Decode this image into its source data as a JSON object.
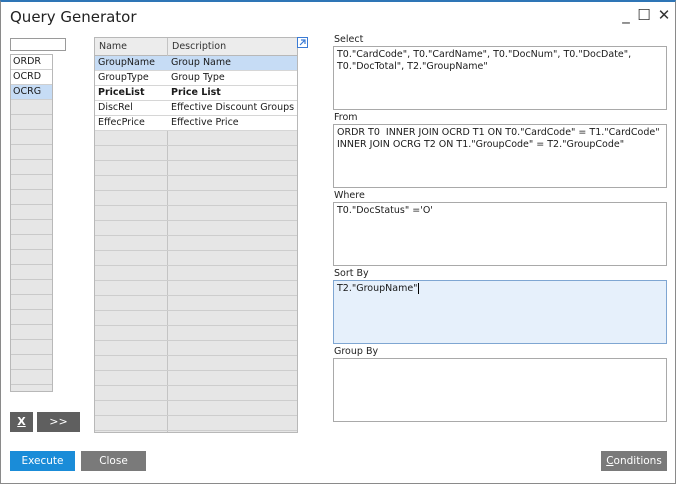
{
  "window": {
    "title": "Query Generator",
    "minimize": "_",
    "maximize": "☐",
    "close": "✕"
  },
  "tables": {
    "filter_value": "",
    "items": [
      {
        "label": "ORDR",
        "selected": false
      },
      {
        "label": "OCRD",
        "selected": false
      },
      {
        "label": "OCRG",
        "selected": true
      }
    ],
    "remove_label": "X",
    "move_label": ">>"
  },
  "fields_grid": {
    "columns": [
      "Name",
      "Description"
    ],
    "expand_icon": "expand-arrow-icon",
    "rows": [
      {
        "name": "GroupName",
        "description": "Group Name",
        "selected": true,
        "bold": false
      },
      {
        "name": "GroupType",
        "description": "Group Type",
        "selected": false,
        "bold": false
      },
      {
        "name": "PriceList",
        "description": "Price List",
        "selected": false,
        "bold": true
      },
      {
        "name": "DiscRel",
        "description": "Effective Discount Groups",
        "selected": false,
        "bold": false
      },
      {
        "name": "EffecPrice",
        "description": "Effective Price",
        "selected": false,
        "bold": false
      }
    ]
  },
  "query": {
    "select": {
      "label": "Select",
      "value": "T0.\"CardCode\", T0.\"CardName\", T0.\"DocNum\", T0.\"DocDate\",\nT0.\"DocTotal\", T2.\"GroupName\""
    },
    "from": {
      "label": "From",
      "value": "ORDR T0  INNER JOIN OCRD T1 ON T0.\"CardCode\" = T1.\"CardCode\"\nINNER JOIN OCRG T2 ON T1.\"GroupCode\" = T2.\"GroupCode\""
    },
    "where": {
      "label": "Where",
      "value": "T0.\"DocStatus\" ='O'"
    },
    "sort_by": {
      "label": "Sort By",
      "value": "T2.\"GroupName\""
    },
    "group_by": {
      "label": "Group By",
      "value": ""
    }
  },
  "buttons": {
    "execute": "Execute",
    "close": "Close",
    "conditions": "Conditions"
  },
  "colors": {
    "accent": "#1a8cd8",
    "selection": "#c6dcf5",
    "active_field": "#e6f0fb",
    "title_bar_border": "#2e75b6"
  }
}
